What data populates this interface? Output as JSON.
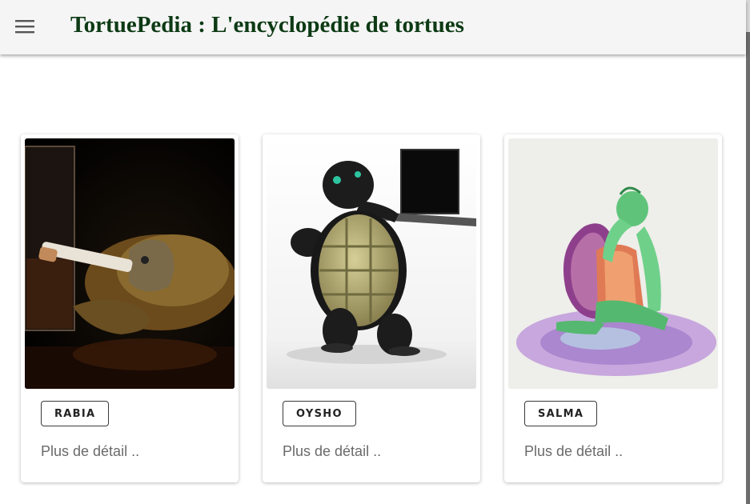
{
  "header": {
    "title": "TortuePedia : L'encyclopédie de tortues",
    "menu_icon": "menu-icon",
    "title_color": "#0c3a14"
  },
  "cards": [
    {
      "name": "RABIA",
      "detail": "Plus de détail ..",
      "image": "turtle-smoking-cigarette-with-whisky-glass"
    },
    {
      "name": "OYSHO",
      "detail": "Plus de détail ..",
      "image": "3d-cartoon-turtle-holding-laptop"
    },
    {
      "name": "SALMA",
      "detail": "Plus de détail ..",
      "image": "drawing-of-thinking-turtle"
    }
  ]
}
